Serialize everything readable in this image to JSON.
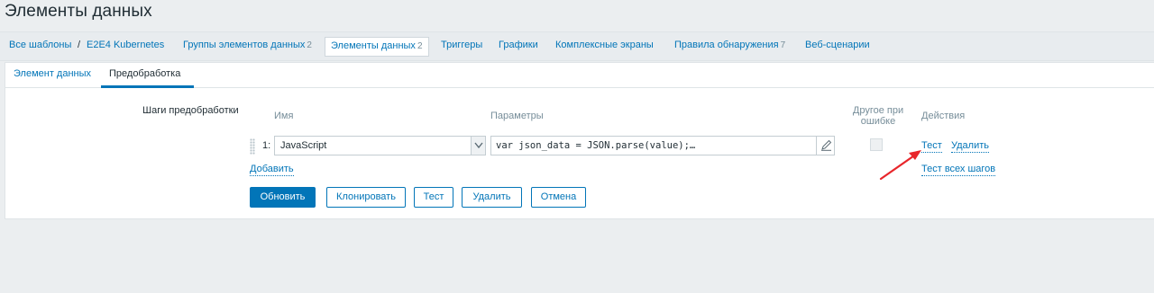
{
  "page": {
    "title": "Элементы данных"
  },
  "nav": {
    "all_templates": "Все шаблоны",
    "separator": "/",
    "template": "E2E4 Kubernetes",
    "tabs": [
      {
        "label": "Группы элементов данных",
        "count": "2"
      },
      {
        "label": "Элементы данных",
        "count": "2",
        "active": true
      },
      {
        "label": "Триггеры",
        "count": ""
      },
      {
        "label": "Графики",
        "count": ""
      },
      {
        "label": "Комплексные экраны",
        "count": ""
      },
      {
        "label": "Правила обнаружения",
        "count": "7"
      },
      {
        "label": "Веб-сценарии",
        "count": ""
      }
    ]
  },
  "subtabs": {
    "item": "Элемент данных",
    "preprocessing": "Предобработка"
  },
  "preprocessing": {
    "label": "Шаги предобработки",
    "headers": {
      "name": "Имя",
      "params": "Параметры",
      "on_fail_1": "Другое при",
      "on_fail_2": "ошибке",
      "actions": "Действия"
    },
    "step": {
      "number": "1:",
      "type": "JavaScript",
      "param": "var json_data = JSON.parse(value);…",
      "on_fail": false,
      "test_link": "Тест",
      "remove_link": "Удалить"
    },
    "add_link": "Добавить",
    "test_all_link": "Тест всех шагов"
  },
  "buttons": {
    "update": "Обновить",
    "clone": "Клонировать",
    "test": "Тест",
    "delete": "Удалить",
    "cancel": "Отмена"
  },
  "colors": {
    "accent": "#0275b8",
    "annotation_arrow": "#e8262b"
  }
}
